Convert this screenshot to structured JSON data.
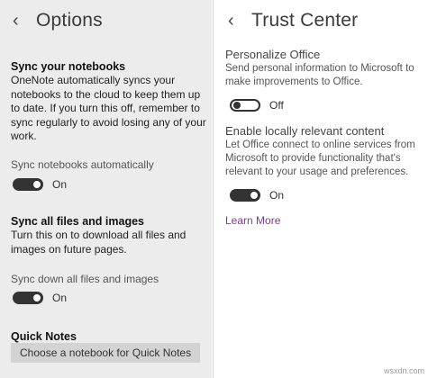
{
  "options": {
    "title": "Options",
    "sync_notebooks": {
      "heading": "Sync your notebooks",
      "lines": [
        "OneNote automatically syncs your",
        "notebooks to the cloud to keep them up",
        "to date. If you turn this off, remember to",
        "sync regularly to avoid losing any of your",
        "work."
      ],
      "setting_label": "Sync notebooks automatically",
      "toggle_state": "On"
    },
    "sync_files": {
      "heading": "Sync all files and images",
      "lines": [
        "Turn this on to download all files and",
        "images on future pages."
      ],
      "setting_label": "Sync down all files and images",
      "toggle_state": "On"
    },
    "quick_notes": {
      "heading": "Quick Notes",
      "button_label": "Choose a notebook for Quick Notes"
    }
  },
  "trust_center": {
    "title": "Trust Center",
    "personalize": {
      "label": "Personalize Office",
      "lines": [
        "Send personal information to Microsoft to",
        "make improvements to Office."
      ],
      "toggle_state": "Off"
    },
    "local_content": {
      "label": "Enable locally relevant content",
      "lines": [
        "Let Office connect to online services from",
        "Microsoft to provide functionality that's",
        "relevant to your usage and preferences."
      ],
      "toggle_state": "On"
    },
    "learn_more": "Learn More"
  },
  "watermark": "wsxdn.com",
  "icons": {
    "back": "chevron-left-icon"
  },
  "colors": {
    "left_pane_bg": "#ececec",
    "toggle_on": "#333333",
    "link": "#7a3d86",
    "button_bg": "#d3d3d3"
  }
}
